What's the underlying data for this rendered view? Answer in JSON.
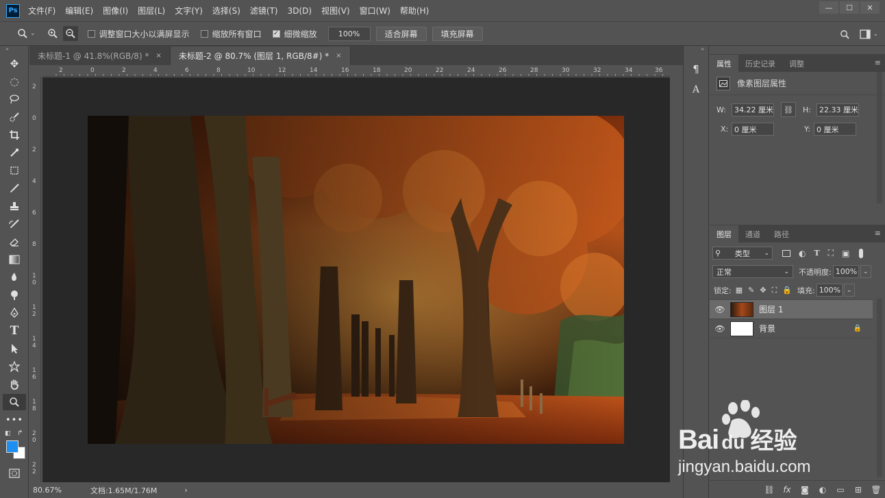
{
  "app": {
    "logo": "Ps"
  },
  "menu": [
    "文件(F)",
    "编辑(E)",
    "图像(I)",
    "图层(L)",
    "文字(Y)",
    "选择(S)",
    "滤镜(T)",
    "3D(D)",
    "视图(V)",
    "窗口(W)",
    "帮助(H)"
  ],
  "options": {
    "resize_windows_label": "调整窗口大小以满屏显示",
    "zoom_all_label": "缩放所有窗口",
    "scrubby_zoom_label": "细微缩放",
    "zoom_value": "100%",
    "fit_screen_label": "适合屏幕",
    "fill_screen_label": "填充屏幕"
  },
  "tabs": [
    {
      "title": "未标题-1 @ 41.8%(RGB/8) *",
      "close": "×"
    },
    {
      "title": "未标题-2 @ 80.7% (图层 1, RGB/8#) *",
      "close": "×"
    }
  ],
  "ruler_top": [
    "2",
    "0",
    "2",
    "4",
    "6",
    "8",
    "10",
    "12",
    "14",
    "16",
    "18",
    "20",
    "22",
    "24",
    "26",
    "28",
    "30",
    "32",
    "34",
    "36"
  ],
  "ruler_left": [
    "2",
    "0",
    "2",
    "4",
    "6",
    "8",
    "1 0",
    "1 2",
    "1 4",
    "1 6",
    "1 8",
    "2 0",
    "2 2"
  ],
  "status": {
    "zoom": "80.67%",
    "doc": "文档:1.65M/1.76M",
    "arrow": "›"
  },
  "properties": {
    "tabs": [
      "属性",
      "历史记录",
      "调整"
    ],
    "header": "像素图层属性",
    "w_label": "W:",
    "w_value": "34.22 厘米",
    "h_label": "H:",
    "h_value": "22.33 厘米",
    "x_label": "X:",
    "x_value": "0 厘米",
    "y_label": "Y:",
    "y_value": "0 厘米"
  },
  "layers_panel": {
    "tabs": [
      "图层",
      "通道",
      "路径"
    ],
    "filter_label": "类型",
    "blend_mode": "正常",
    "opacity_label": "不透明度:",
    "opacity_value": "100%",
    "lock_label": "锁定:",
    "fill_label": "填充:",
    "fill_value": "100%",
    "layers": [
      {
        "name": "图层 1",
        "selected": true
      },
      {
        "name": "背景",
        "locked": true
      }
    ]
  },
  "watermark": {
    "brand": "Bai",
    "brand2": "du",
    "suffix": "经验",
    "url": "jingyan.baidu.com"
  },
  "colors": {
    "foreground": "#1e8ef0",
    "background": "#ffffff",
    "accent": "#31a8ff"
  }
}
